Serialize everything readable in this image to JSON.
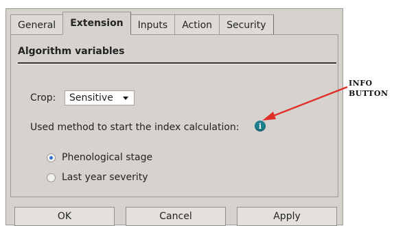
{
  "tabs": [
    {
      "label": "General",
      "active": false
    },
    {
      "label": "Extension",
      "active": true
    },
    {
      "label": "Inputs",
      "active": false
    },
    {
      "label": "Action",
      "active": false
    },
    {
      "label": "Security",
      "active": false
    }
  ],
  "section": {
    "title": "Algorithm variables"
  },
  "crop": {
    "label": "Crop:",
    "value": "Sensitive"
  },
  "method": {
    "label": "Used method to start the index calculation:"
  },
  "info_button": {
    "glyph": "i",
    "icon": "info-icon",
    "color": "#1e7f8f"
  },
  "radios": [
    {
      "label": "Phenological stage",
      "checked": true
    },
    {
      "label": "Last year severity",
      "checked": false
    }
  ],
  "buttons": {
    "ok": "OK",
    "cancel": "Cancel",
    "apply": "Apply"
  },
  "annotation": {
    "line1": "INFO",
    "line2": "BUTTON",
    "arrow_color": "#e0302a"
  }
}
